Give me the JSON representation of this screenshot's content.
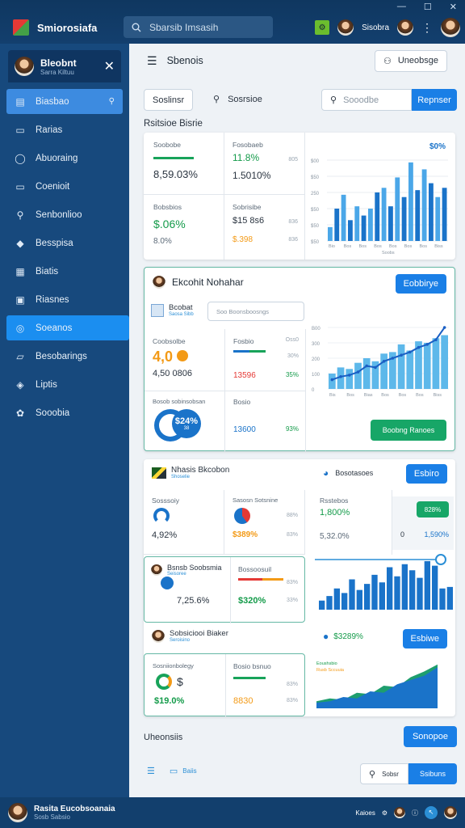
{
  "window": {
    "minimize": "—",
    "maximize": "☐",
    "close": "✕"
  },
  "app": {
    "title": "Smiorosiafa"
  },
  "search": {
    "placeholder": "Sbarsib Imsasih"
  },
  "topbar": {
    "user_label": "Sisobra"
  },
  "sidebar": {
    "user_name": "Bleobnt",
    "user_sub": "Sarra Kiltuu",
    "items": [
      {
        "label": "Biasbao",
        "icon": "id-card-icon",
        "selected": true
      },
      {
        "label": "Rarias",
        "icon": "chat-icon"
      },
      {
        "label": "Abuoraing",
        "icon": "comment-icon"
      },
      {
        "label": "Coenioit",
        "icon": "folder-icon"
      },
      {
        "label": "Senbonlioo",
        "icon": "pin-icon"
      },
      {
        "label": "Besspisa",
        "icon": "tag-icon"
      },
      {
        "label": "Biatis",
        "icon": "store-icon"
      },
      {
        "label": "Riasnes",
        "icon": "calendar-icon"
      },
      {
        "label": "Soeanos",
        "icon": "link-icon",
        "active": true
      },
      {
        "label": "Besobarings",
        "icon": "message-icon"
      },
      {
        "label": "Liptis",
        "icon": "shield-icon"
      },
      {
        "label": "Sooobia",
        "icon": "gear-icon"
      }
    ]
  },
  "main": {
    "header_title": "Sbenois",
    "header_button": "Uneobsge",
    "filter_button": "Soslinsr",
    "filter_label": "Sosrsioe",
    "search_placeholder": "Sooodbe",
    "search_button": "Repnser",
    "section_title": "Rsitsioe Bisrie"
  },
  "card1": {
    "c1_label": "Soobobe",
    "c1_value": "8,59.03%",
    "c2_label": "Fosobaeb",
    "c2_value": "11.8%",
    "c2_value2": "1.5010%",
    "c2_note": "805",
    "c3_label": "Bobsbios",
    "c3_value": "$.06%",
    "c3_value2": "8.0%",
    "c4_label": "Sobrisibe",
    "c4_value": "$15 8s6",
    "c4_value2": "$.398",
    "c4_note1": "836",
    "c4_note2": "836",
    "chart_pct": "$0%"
  },
  "chart1": {
    "type": "bar",
    "values": [
      12,
      28,
      40,
      18,
      30,
      22,
      28,
      42,
      46,
      30,
      55,
      38,
      68,
      44,
      62,
      50,
      38,
      46
    ],
    "xlabels": [
      "Bio",
      "Bos",
      "Bos",
      "Bos",
      "Bos",
      "Bos",
      "Bos",
      "Biss"
    ],
    "ylabels": [
      "$50",
      "$50",
      "$50",
      "250",
      "$50",
      "$00"
    ],
    "footer": "Soobs"
  },
  "card2": {
    "title": "Ekcohit Nohahar",
    "action": "Eobbirye",
    "sub_title": "Bcobat",
    "sub_sub": "Saosa Sibb",
    "input_placeholder": "Soo Boonsboosngs",
    "c1_label": "Coobsolbe",
    "c1_value": "4,0",
    "c1_value2": "4,50 0806",
    "c2_label": "Fosbio",
    "c2_note": "Oss0",
    "c2_value": "13596",
    "c2_note2": "30%",
    "c2_note3": "35%",
    "c3_label": "Bosob sobinsobsan",
    "c3_value": "$24%",
    "c3_sub": "38",
    "c4_label": "Bosio",
    "c4_value": "13600",
    "c4_note": "93%",
    "green_button": "Boobng Ranoes"
  },
  "chart2": {
    "type": "bar+line",
    "bars": [
      20,
      28,
      26,
      34,
      40,
      36,
      46,
      48,
      58,
      50,
      62,
      60,
      66,
      70
    ],
    "line": [
      12,
      16,
      18,
      22,
      30,
      28,
      36,
      40,
      44,
      48,
      54,
      58,
      64,
      80
    ],
    "xlabels": [
      "Bis",
      "Bos",
      "Bias",
      "Bos",
      "Bos",
      "Bos",
      "Biss"
    ],
    "ylabels": [
      "B00",
      "300",
      "200",
      "100",
      "0"
    ]
  },
  "card3": {
    "title": "Nhasis Bkcobon",
    "sub": "Shoselie",
    "action": "Esbiro",
    "label2": "Bosotasoes",
    "c1_label": "Sosssoiy",
    "c1_value": "4,92%",
    "c2_label": "Sasosn Sotsnine",
    "c2_value": "$389%",
    "c2_note": "88%",
    "c2_note2": "83%",
    "c3_label": "Rsstebos",
    "c3_value": "1,800%",
    "c3_value2": "5,32.0%",
    "c3_badge": "828%",
    "c3_num": "0",
    "c3_num2": "1,590%"
  },
  "card4": {
    "title": "Bsnsb Soobsmia",
    "sub": "Seisoree",
    "value": "7,25.6%",
    "c2_label": "Bossoosuil",
    "c2_value": "$320%",
    "note": "83%",
    "note2": "33%"
  },
  "chart3": {
    "type": "bar",
    "values": [
      12,
      18,
      28,
      22,
      40,
      26,
      34,
      46,
      36,
      56,
      44,
      60,
      52,
      42,
      64,
      58,
      28,
      30
    ]
  },
  "card5": {
    "title": "Sobsiciooi Biaker",
    "sub": "Seroisino",
    "pct": "$3289%",
    "action": "Esbiwe",
    "c1_label": "Sosniionbolegy",
    "c1_value": "$19.0%",
    "c2_label": "Bosio bsnuo",
    "c2_value": "8830",
    "c2_note": "83%",
    "c2_note2": "83%"
  },
  "chart4": {
    "type": "area",
    "series1": [
      10,
      14,
      12,
      22,
      20,
      32,
      30,
      44,
      52,
      62
    ],
    "series2": [
      8,
      10,
      16,
      14,
      24,
      22,
      34,
      40,
      46,
      58
    ],
    "label1": "Eoushsbio",
    "label2": "Rusb Sccuuia"
  },
  "footer": {
    "title": "Uheonsiis",
    "action": "Sonopoe",
    "link": "Baiis",
    "btn1": "Sobsr",
    "btn2": "Ssibuns"
  },
  "bottom": {
    "user": "Rasita Eucobsoanaia",
    "sub": "Sosb Sabsio",
    "right_label": "Kaioes"
  }
}
